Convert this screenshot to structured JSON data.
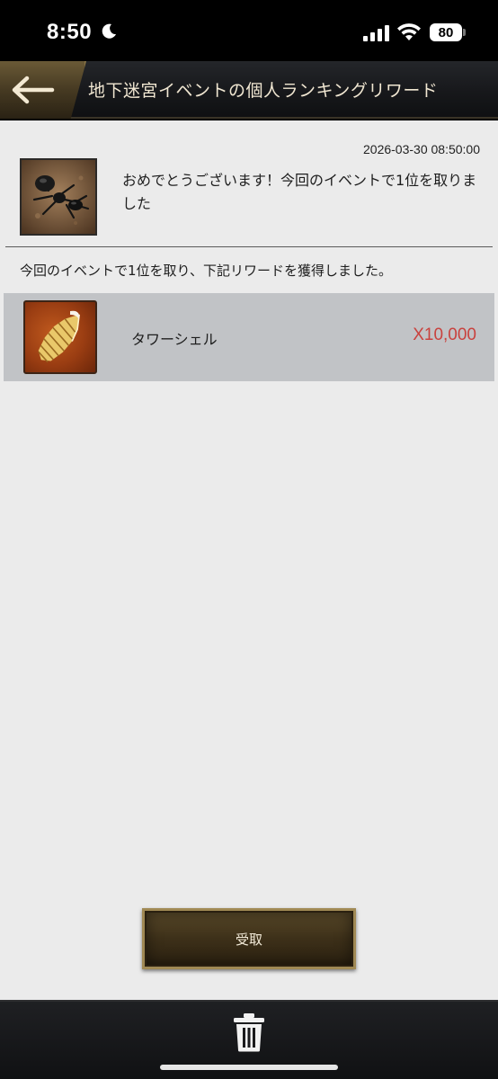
{
  "status_bar": {
    "time": "8:50",
    "battery": "80"
  },
  "header": {
    "title": "地下迷宮イベントの個人ランキングリワード"
  },
  "mail": {
    "timestamp": "2026-03-30 08:50:00",
    "message": "おめでとうございます！今回のイベントで1位を取りました",
    "body": "今回のイベントで1位を取り、下記リワードを獲得しました。",
    "reward": {
      "name": "タワーシェル",
      "quantity": "X10,000",
      "icon": "tower-shell-icon"
    }
  },
  "actions": {
    "claim_label": "受取"
  },
  "colors": {
    "quantity": "#c9423e",
    "accent_gold": "#a08954"
  }
}
